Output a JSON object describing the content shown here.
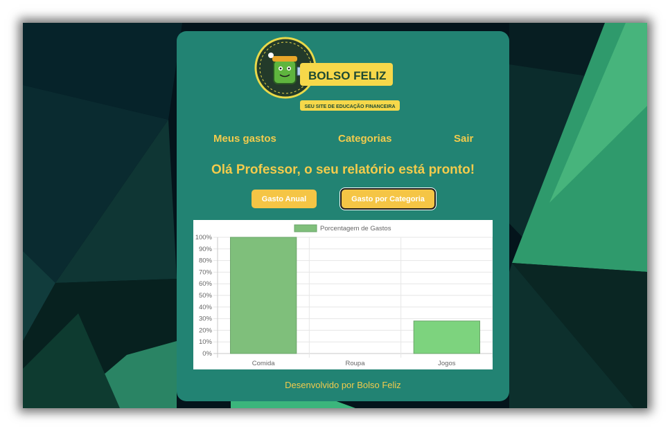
{
  "logo": {
    "brand": "BOLSO FELIZ",
    "tagline": "SEU SITE DE EDUCAÇÃO FINANCEIRA"
  },
  "nav": {
    "items": [
      "Meus gastos",
      "Categorias",
      "Sair"
    ]
  },
  "main": {
    "greeting": "Olá Professor, o seu relatório está pronto!",
    "buttons": [
      "Gasto Anual",
      "Gasto por Categoria"
    ],
    "active_button": "Gasto por Categoria"
  },
  "chart_data": {
    "type": "bar",
    "categories": [
      "Comida",
      "Roupa",
      "Jogos"
    ],
    "series": [
      {
        "name": "Porcentagem de Gastos",
        "values": [
          100,
          0,
          28
        ]
      }
    ],
    "y_ticks": [
      "0%",
      "10%",
      "20%",
      "30%",
      "40%",
      "50%",
      "60%",
      "70%",
      "80%",
      "90%",
      "100%"
    ],
    "ylim": [
      0,
      100
    ],
    "grid": true,
    "legend": "top",
    "colors": {
      "bar_1": "#7fbf7b",
      "bar_3": "#7dd37e",
      "legend": "#7fbf7b"
    }
  },
  "footer": {
    "text": "Desenvolvido por Bolso Feliz"
  },
  "colors": {
    "accent": "#f3cb4c",
    "card": "#228373",
    "button": "#f5c545"
  }
}
